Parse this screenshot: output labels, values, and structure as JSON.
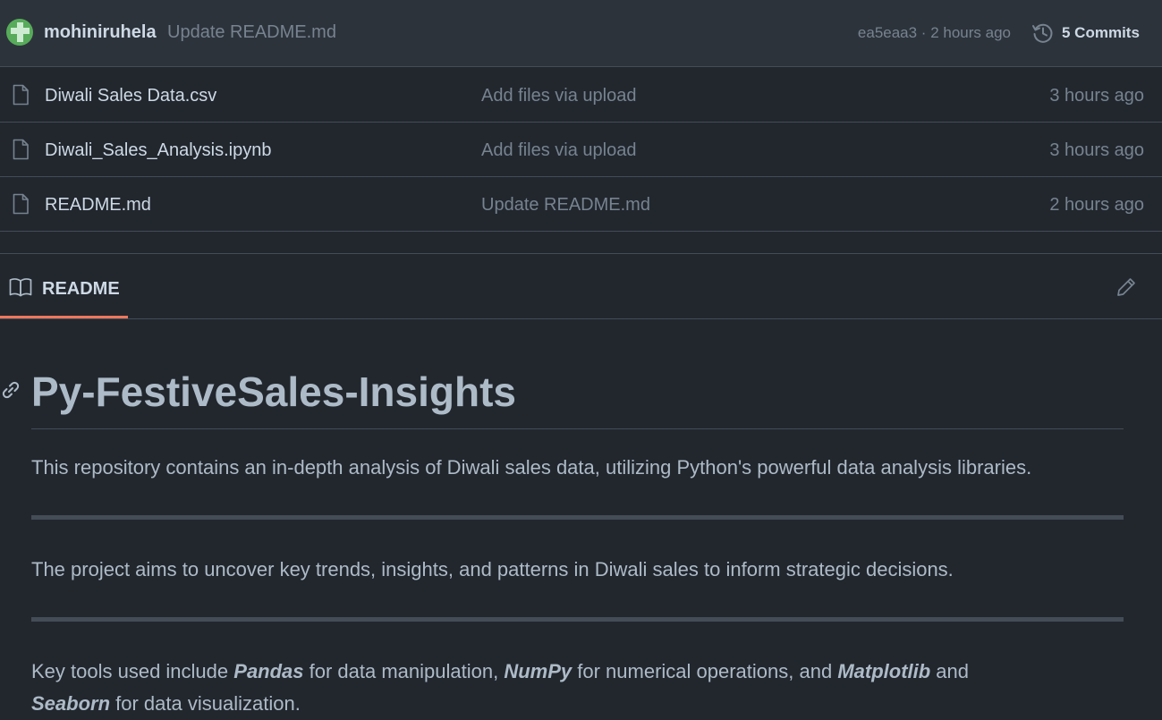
{
  "latest_commit": {
    "author": "mohiniruhela",
    "message": "Update README.md",
    "meta": "ea5eaa3 · 2 hours ago",
    "commits_label": "5 Commits"
  },
  "files": [
    {
      "name": "Diwali Sales Data.csv",
      "message": "Add files via upload",
      "time": "3 hours ago"
    },
    {
      "name": "Diwali_Sales_Analysis.ipynb",
      "message": "Add files via upload",
      "time": "3 hours ago"
    },
    {
      "name": "README.md",
      "message": "Update README.md",
      "time": "2 hours ago"
    }
  ],
  "readme": {
    "tab_label": "README",
    "title": "Py-FestiveSales-Insights",
    "para1": "This repository contains an in-depth analysis of Diwali sales data, utilizing Python's powerful data analysis libraries.",
    "para2": "The project aims to uncover key trends, insights, and patterns in Diwali sales to inform strategic decisions.",
    "para3": {
      "t1": "Key tools used include ",
      "pandas": "Pandas",
      "t2": " for data manipulation, ",
      "numpy": "NumPy",
      "t3": " for numerical operations, and ",
      "matplotlib": "Matplotlib",
      "t4": " and",
      "seaborn": "Seaborn",
      "t5": " for data visualization."
    }
  },
  "colors": {
    "background": "#22272e",
    "accent_underline": "#ec775c",
    "avatar": "#57ab5a"
  },
  "icons": [
    "avatar",
    "history-icon",
    "file-icon",
    "book-icon",
    "pencil-icon",
    "link-icon"
  ]
}
